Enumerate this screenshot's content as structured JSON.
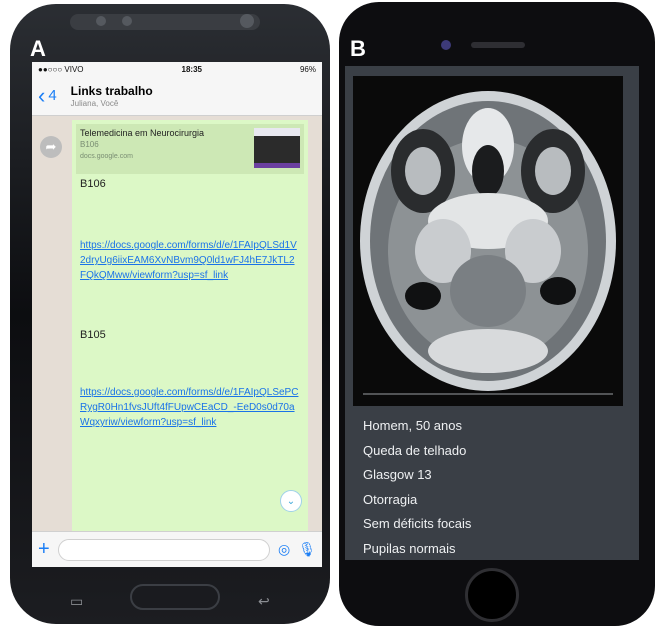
{
  "panels": {
    "a_label": "A",
    "b_label": "B"
  },
  "whatsapp": {
    "status": {
      "carrier": "●●○○○ VIVO",
      "time": "18:35",
      "battery": "96%"
    },
    "header": {
      "back_count": "4",
      "title": "Links trabalho",
      "subtitle": "Juliana, Você"
    },
    "preview": {
      "title": "Telemedicina em Neurocirurgia",
      "subtitle": "B106",
      "domain": "docs.google.com"
    },
    "messages": [
      {
        "label": "B106",
        "link": "https://docs.google.com/forms/d/e/1FAIpQLSd1V2dryUg6iixEAM6XvNBvm9Q0ld1wFJ4hE7JkTL2FQkQMww/viewform?usp=sf_link"
      },
      {
        "label": "B105",
        "link": "https://docs.google.com/forms/d/e/1FAIpQLSePCRygR0Hn1fvsJUft4fFUpwCEaCD_-EeD0s0d70aWqxyriw/viewform?usp=sf_link"
      }
    ]
  },
  "ct_case": {
    "lines": [
      "Homem, 50 anos",
      "Queda de telhado",
      "Glasgow 13",
      "Otorragia",
      "Sem déficits focais",
      "Pupilas normais"
    ]
  },
  "colors": {
    "ios_blue": "#1b7ef5",
    "bubble_green": "#dcf8c6",
    "link_blue": "#1a73e8"
  }
}
